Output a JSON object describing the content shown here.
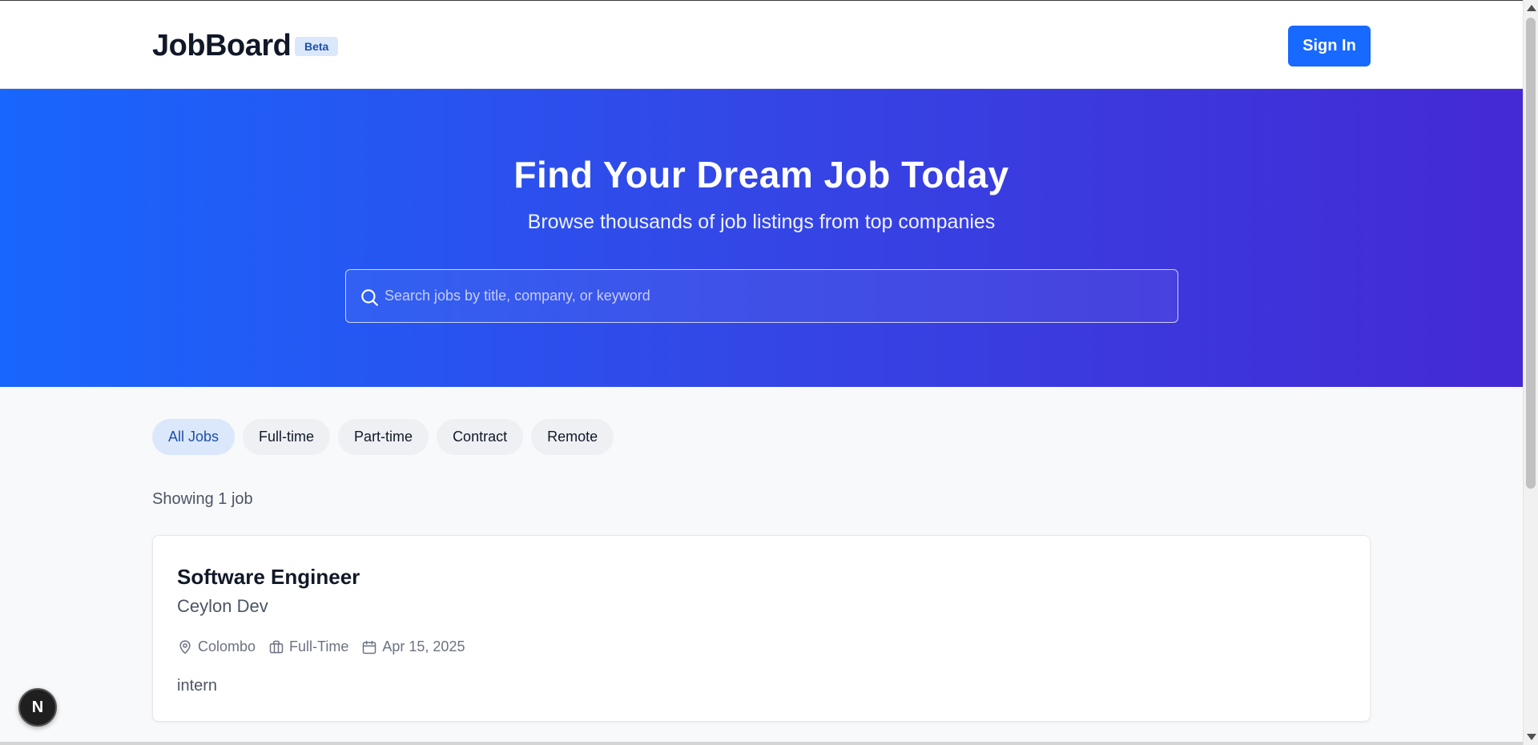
{
  "header": {
    "logo": "JobBoard",
    "badge": "Beta",
    "signin_label": "Sign In"
  },
  "hero": {
    "title": "Find Your Dream Job Today",
    "subtitle": "Browse thousands of job listings from top companies",
    "search_placeholder": "Search jobs by title, company, or keyword",
    "search_value": ""
  },
  "filters": {
    "items": [
      {
        "label": "All Jobs",
        "active": true
      },
      {
        "label": "Full-time",
        "active": false
      },
      {
        "label": "Part-time",
        "active": false
      },
      {
        "label": "Contract",
        "active": false
      },
      {
        "label": "Remote",
        "active": false
      }
    ]
  },
  "results": {
    "count_text": "Showing 1 job"
  },
  "jobs": [
    {
      "title": "Software Engineer",
      "company": "Ceylon Dev",
      "location": "Colombo",
      "type": "Full-Time",
      "date": "Apr 15, 2025",
      "description": "intern"
    }
  ],
  "dev_badge": {
    "label": "N"
  },
  "icons": {
    "search": "search-icon",
    "location": "map-pin-icon",
    "type": "briefcase-icon",
    "date": "calendar-icon"
  },
  "colors": {
    "primary": "#1769ff",
    "hero_start": "#1866fd",
    "hero_end": "#4429d4",
    "chip_active_bg": "#dbe8fb",
    "chip_active_text": "#1e4fa8"
  }
}
